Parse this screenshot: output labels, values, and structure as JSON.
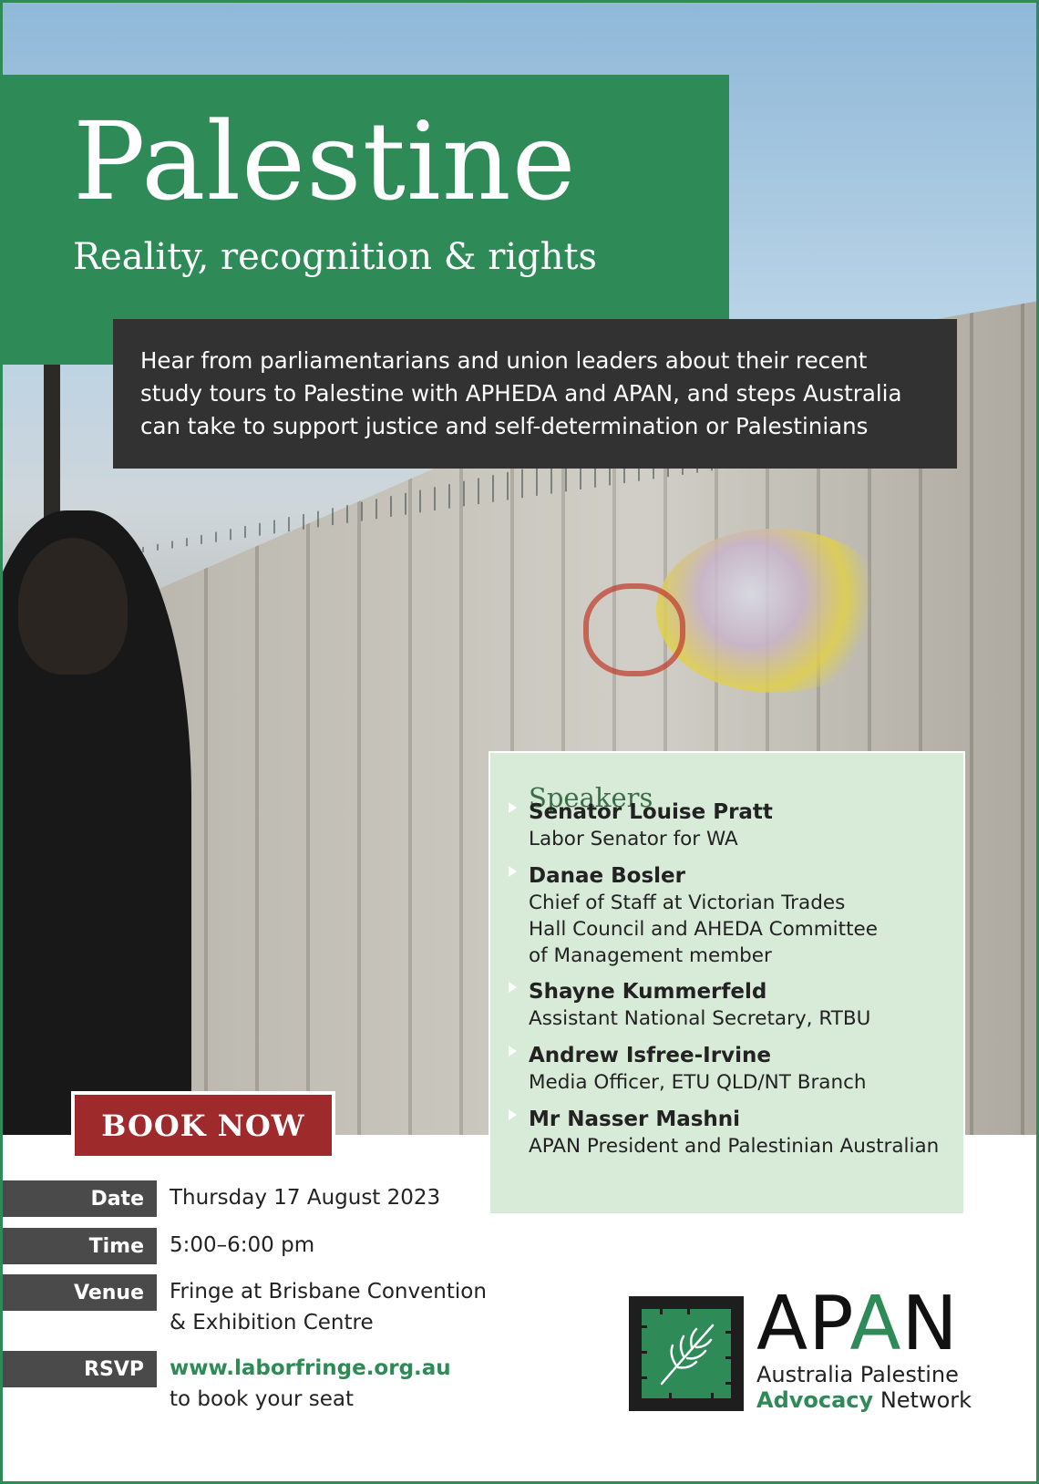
{
  "header": {
    "title": "Palestine",
    "subtitle": "Reality, recognition & rights"
  },
  "intro": {
    "lines": [
      "Hear from parliamentarians and union leaders about their recent",
      "study tours to Palestine with APHEDA and APAN, and steps Australia",
      "can take to support justice and self-determination or Palestinians"
    ]
  },
  "speakers": {
    "heading": "Speakers",
    "items": [
      {
        "name": "Senator Louise Pratt",
        "role": [
          "Labor Senator for WA"
        ]
      },
      {
        "name": "Danae Bosler",
        "role": [
          "Chief of Staff at Victorian Trades",
          "Hall Council and AHEDA Committee",
          "of Management member"
        ]
      },
      {
        "name": "Shayne Kummerfeld",
        "role": [
          "Assistant National Secretary, RTBU"
        ]
      },
      {
        "name": "Andrew Isfree-Irvine",
        "role": [
          "Media Officer, ETU QLD/NT Branch"
        ]
      },
      {
        "name": "Mr Nasser Mashni",
        "role": [
          "APAN President and Palestinian Australian"
        ]
      }
    ]
  },
  "booking": {
    "button_label": "BOOK NOW"
  },
  "details": {
    "date_label": "Date",
    "date_value": "Thursday 17 August 2023",
    "time_label": "Time",
    "time_value": "5:00–6:00 pm",
    "venue_label": "Venue",
    "venue_line1": "Fringe at Brisbane Convention",
    "venue_line2": "& Exhibition Centre",
    "rsvp_label": "RSVP",
    "rsvp_link": "www.laborfringe.org.au",
    "rsvp_note": "to book your seat"
  },
  "logo": {
    "apan_prefix": "AP",
    "apan_accent": "A",
    "apan_suffix": "N",
    "line1": "Australia Palestine",
    "line2_accent": "Advocacy",
    "line2_rest": " Network",
    "icon": "olive-branch-icon"
  },
  "colors": {
    "green": "#2e8b57",
    "dark": "#323232",
    "book_red": "#9e2a2b",
    "speakers_bg": "#d8ead8"
  }
}
